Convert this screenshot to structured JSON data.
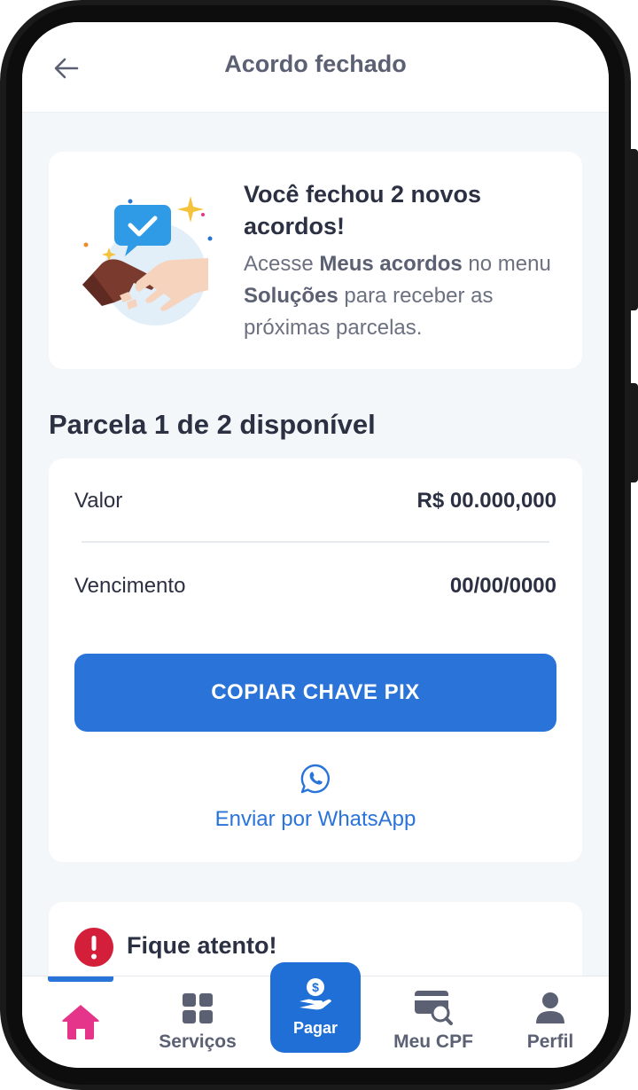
{
  "header": {
    "title": "Acordo fechado"
  },
  "deal_card": {
    "title": "Você fechou 2 novos acordos!",
    "desc_part1": "Acesse ",
    "desc_bold1": "Meus acordos",
    "desc_part2": " no menu ",
    "desc_bold2": "Soluções",
    "desc_part3": " para receber as próximas parcelas."
  },
  "parcel": {
    "section_title": "Parcela 1 de 2 disponível",
    "value_label": "Valor",
    "value": "R$ 00.000,000",
    "due_label": "Vencimento",
    "due": "00/00/0000",
    "pix_button": "COPIAR CHAVE PIX",
    "whatsapp_link": "Enviar por WhatsApp"
  },
  "attention": {
    "title": "Fique atento!"
  },
  "nav": {
    "home": "",
    "services": "Serviços",
    "pay": "Pagar",
    "cpf": "Meu CPF",
    "profile": "Perfil"
  },
  "colors": {
    "primary": "#2a73d9",
    "home_pink": "#e5358a",
    "alert_red": "#d41f3a",
    "text_dark": "#2b3042"
  }
}
